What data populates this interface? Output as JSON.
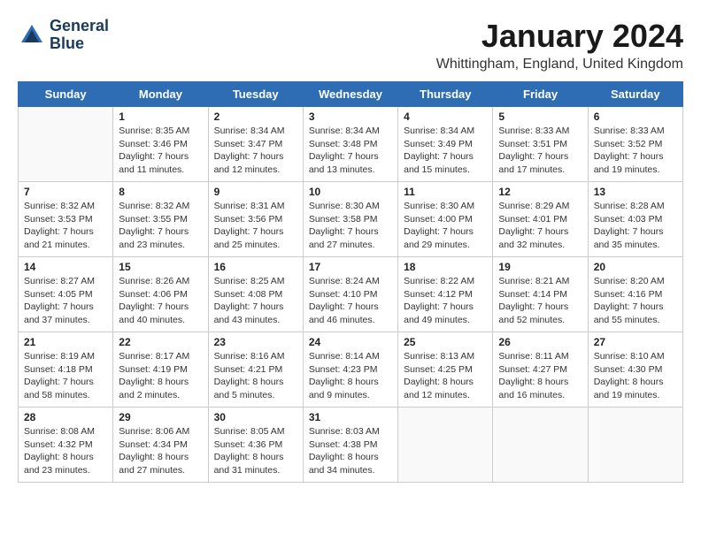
{
  "logo": {
    "line1": "General",
    "line2": "Blue"
  },
  "title": "January 2024",
  "subtitle": "Whittingham, England, United Kingdom",
  "headers": [
    "Sunday",
    "Monday",
    "Tuesday",
    "Wednesday",
    "Thursday",
    "Friday",
    "Saturday"
  ],
  "weeks": [
    [
      {
        "day": "",
        "sunrise": "",
        "sunset": "",
        "daylight": ""
      },
      {
        "day": "1",
        "sunrise": "Sunrise: 8:35 AM",
        "sunset": "Sunset: 3:46 PM",
        "daylight": "Daylight: 7 hours and 11 minutes."
      },
      {
        "day": "2",
        "sunrise": "Sunrise: 8:34 AM",
        "sunset": "Sunset: 3:47 PM",
        "daylight": "Daylight: 7 hours and 12 minutes."
      },
      {
        "day": "3",
        "sunrise": "Sunrise: 8:34 AM",
        "sunset": "Sunset: 3:48 PM",
        "daylight": "Daylight: 7 hours and 13 minutes."
      },
      {
        "day": "4",
        "sunrise": "Sunrise: 8:34 AM",
        "sunset": "Sunset: 3:49 PM",
        "daylight": "Daylight: 7 hours and 15 minutes."
      },
      {
        "day": "5",
        "sunrise": "Sunrise: 8:33 AM",
        "sunset": "Sunset: 3:51 PM",
        "daylight": "Daylight: 7 hours and 17 minutes."
      },
      {
        "day": "6",
        "sunrise": "Sunrise: 8:33 AM",
        "sunset": "Sunset: 3:52 PM",
        "daylight": "Daylight: 7 hours and 19 minutes."
      }
    ],
    [
      {
        "day": "7",
        "sunrise": "Sunrise: 8:32 AM",
        "sunset": "Sunset: 3:53 PM",
        "daylight": "Daylight: 7 hours and 21 minutes."
      },
      {
        "day": "8",
        "sunrise": "Sunrise: 8:32 AM",
        "sunset": "Sunset: 3:55 PM",
        "daylight": "Daylight: 7 hours and 23 minutes."
      },
      {
        "day": "9",
        "sunrise": "Sunrise: 8:31 AM",
        "sunset": "Sunset: 3:56 PM",
        "daylight": "Daylight: 7 hours and 25 minutes."
      },
      {
        "day": "10",
        "sunrise": "Sunrise: 8:30 AM",
        "sunset": "Sunset: 3:58 PM",
        "daylight": "Daylight: 7 hours and 27 minutes."
      },
      {
        "day": "11",
        "sunrise": "Sunrise: 8:30 AM",
        "sunset": "Sunset: 4:00 PM",
        "daylight": "Daylight: 7 hours and 29 minutes."
      },
      {
        "day": "12",
        "sunrise": "Sunrise: 8:29 AM",
        "sunset": "Sunset: 4:01 PM",
        "daylight": "Daylight: 7 hours and 32 minutes."
      },
      {
        "day": "13",
        "sunrise": "Sunrise: 8:28 AM",
        "sunset": "Sunset: 4:03 PM",
        "daylight": "Daylight: 7 hours and 35 minutes."
      }
    ],
    [
      {
        "day": "14",
        "sunrise": "Sunrise: 8:27 AM",
        "sunset": "Sunset: 4:05 PM",
        "daylight": "Daylight: 7 hours and 37 minutes."
      },
      {
        "day": "15",
        "sunrise": "Sunrise: 8:26 AM",
        "sunset": "Sunset: 4:06 PM",
        "daylight": "Daylight: 7 hours and 40 minutes."
      },
      {
        "day": "16",
        "sunrise": "Sunrise: 8:25 AM",
        "sunset": "Sunset: 4:08 PM",
        "daylight": "Daylight: 7 hours and 43 minutes."
      },
      {
        "day": "17",
        "sunrise": "Sunrise: 8:24 AM",
        "sunset": "Sunset: 4:10 PM",
        "daylight": "Daylight: 7 hours and 46 minutes."
      },
      {
        "day": "18",
        "sunrise": "Sunrise: 8:22 AM",
        "sunset": "Sunset: 4:12 PM",
        "daylight": "Daylight: 7 hours and 49 minutes."
      },
      {
        "day": "19",
        "sunrise": "Sunrise: 8:21 AM",
        "sunset": "Sunset: 4:14 PM",
        "daylight": "Daylight: 7 hours and 52 minutes."
      },
      {
        "day": "20",
        "sunrise": "Sunrise: 8:20 AM",
        "sunset": "Sunset: 4:16 PM",
        "daylight": "Daylight: 7 hours and 55 minutes."
      }
    ],
    [
      {
        "day": "21",
        "sunrise": "Sunrise: 8:19 AM",
        "sunset": "Sunset: 4:18 PM",
        "daylight": "Daylight: 7 hours and 58 minutes."
      },
      {
        "day": "22",
        "sunrise": "Sunrise: 8:17 AM",
        "sunset": "Sunset: 4:19 PM",
        "daylight": "Daylight: 8 hours and 2 minutes."
      },
      {
        "day": "23",
        "sunrise": "Sunrise: 8:16 AM",
        "sunset": "Sunset: 4:21 PM",
        "daylight": "Daylight: 8 hours and 5 minutes."
      },
      {
        "day": "24",
        "sunrise": "Sunrise: 8:14 AM",
        "sunset": "Sunset: 4:23 PM",
        "daylight": "Daylight: 8 hours and 9 minutes."
      },
      {
        "day": "25",
        "sunrise": "Sunrise: 8:13 AM",
        "sunset": "Sunset: 4:25 PM",
        "daylight": "Daylight: 8 hours and 12 minutes."
      },
      {
        "day": "26",
        "sunrise": "Sunrise: 8:11 AM",
        "sunset": "Sunset: 4:27 PM",
        "daylight": "Daylight: 8 hours and 16 minutes."
      },
      {
        "day": "27",
        "sunrise": "Sunrise: 8:10 AM",
        "sunset": "Sunset: 4:30 PM",
        "daylight": "Daylight: 8 hours and 19 minutes."
      }
    ],
    [
      {
        "day": "28",
        "sunrise": "Sunrise: 8:08 AM",
        "sunset": "Sunset: 4:32 PM",
        "daylight": "Daylight: 8 hours and 23 minutes."
      },
      {
        "day": "29",
        "sunrise": "Sunrise: 8:06 AM",
        "sunset": "Sunset: 4:34 PM",
        "daylight": "Daylight: 8 hours and 27 minutes."
      },
      {
        "day": "30",
        "sunrise": "Sunrise: 8:05 AM",
        "sunset": "Sunset: 4:36 PM",
        "daylight": "Daylight: 8 hours and 31 minutes."
      },
      {
        "day": "31",
        "sunrise": "Sunrise: 8:03 AM",
        "sunset": "Sunset: 4:38 PM",
        "daylight": "Daylight: 8 hours and 34 minutes."
      },
      {
        "day": "",
        "sunrise": "",
        "sunset": "",
        "daylight": ""
      },
      {
        "day": "",
        "sunrise": "",
        "sunset": "",
        "daylight": ""
      },
      {
        "day": "",
        "sunrise": "",
        "sunset": "",
        "daylight": ""
      }
    ]
  ]
}
